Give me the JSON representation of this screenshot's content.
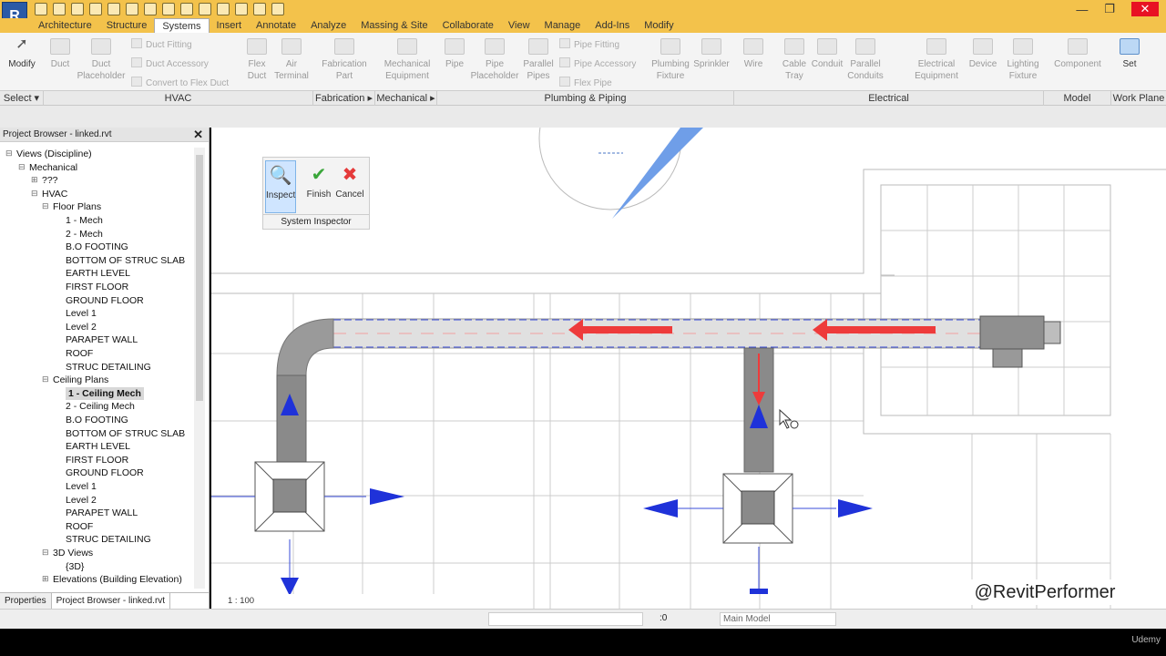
{
  "app": {
    "logo": "R",
    "window_controls": [
      "—",
      "❐",
      "✕"
    ]
  },
  "menu_tabs": [
    "Architecture",
    "Structure",
    "Systems",
    "Insert",
    "Annotate",
    "Analyze",
    "Massing & Site",
    "Collaborate",
    "View",
    "Manage",
    "Add-Ins",
    "Modify"
  ],
  "active_tab": "Systems",
  "ribbon": {
    "modify": "Modify",
    "select": "Select",
    "hvac": {
      "duct": "Duct",
      "duct_placeholder": "Duct\nPlaceholder",
      "duct_fitting": "Duct Fitting",
      "duct_accessory": "Duct Accessory",
      "convert_flex": "Convert to Flex Duct",
      "flex_duct": "Flex\nDuct",
      "air_terminal": "Air\nTerminal"
    },
    "fabrication_part": "Fabrication\nPart",
    "mechanical_equipment": "Mechanical\nEquipment",
    "plumbing": {
      "pipe": "Pipe",
      "pipe_placeholder": "Pipe\nPlaceholder",
      "parallel_pipes": "Parallel\nPipes",
      "pipe_fitting": "Pipe Fitting",
      "pipe_accessory": "Pipe Accessory",
      "flex_pipe": "Flex Pipe",
      "plumbing_fixture": "Plumbing\nFixture",
      "sprinkler": "Sprinkler"
    },
    "electrical": {
      "wire": "Wire",
      "cable_tray": "Cable\nTray",
      "conduit": "Conduit",
      "parallel_conduits": "Parallel\nConduits",
      "electrical_equipment": "Electrical\nEquipment",
      "device": "Device",
      "lighting_fixture": "Lighting\nFixture"
    },
    "component": "Component",
    "set": "Set",
    "groups": {
      "select": "Select ▾",
      "hvac": "HVAC",
      "fabrication": "Fabrication ▸",
      "mechanical": "Mechanical ▸",
      "plumbing": "Plumbing & Piping",
      "electrical": "Electrical",
      "model": "Model",
      "work_plane": "Work Plane"
    }
  },
  "project_browser": {
    "title": "Project Browser - linked.rvt",
    "close": "✕",
    "tree": [
      {
        "label": "Views (Discipline)",
        "level": 0,
        "exp": "⊟"
      },
      {
        "label": "Mechanical",
        "level": 1,
        "exp": "⊟"
      },
      {
        "label": "???",
        "level": 2,
        "exp": "⊞"
      },
      {
        "label": "HVAC",
        "level": 2,
        "exp": "⊟"
      },
      {
        "label": "Floor Plans",
        "level": 3,
        "exp": "⊟"
      },
      {
        "label": "1 - Mech",
        "level": 4
      },
      {
        "label": "2 - Mech",
        "level": 4
      },
      {
        "label": "B.O FOOTING",
        "level": 4
      },
      {
        "label": "BOTTOM OF STRUC SLAB",
        "level": 4
      },
      {
        "label": "EARTH LEVEL",
        "level": 4
      },
      {
        "label": "FIRST FLOOR",
        "level": 4
      },
      {
        "label": "GROUND FLOOR",
        "level": 4
      },
      {
        "label": "Level 1",
        "level": 4
      },
      {
        "label": "Level 2",
        "level": 4
      },
      {
        "label": "PARAPET WALL",
        "level": 4
      },
      {
        "label": "ROOF",
        "level": 4
      },
      {
        "label": "STRUC DETAILING",
        "level": 4
      },
      {
        "label": "Ceiling Plans",
        "level": 3,
        "exp": "⊟"
      },
      {
        "label": "1 - Ceiling Mech",
        "level": 4,
        "selected": true
      },
      {
        "label": "2 - Ceiling Mech",
        "level": 4
      },
      {
        "label": "B.O FOOTING",
        "level": 4
      },
      {
        "label": "BOTTOM OF STRUC SLAB",
        "level": 4
      },
      {
        "label": "EARTH LEVEL",
        "level": 4
      },
      {
        "label": "FIRST FLOOR",
        "level": 4
      },
      {
        "label": "GROUND FLOOR",
        "level": 4
      },
      {
        "label": "Level 1",
        "level": 4
      },
      {
        "label": "Level 2",
        "level": 4
      },
      {
        "label": "PARAPET WALL",
        "level": 4
      },
      {
        "label": "ROOF",
        "level": 4
      },
      {
        "label": "STRUC DETAILING",
        "level": 4
      },
      {
        "label": "3D Views",
        "level": 3,
        "exp": "⊟"
      },
      {
        "label": "{3D}",
        "level": 4
      },
      {
        "label": "Elevations (Building Elevation)",
        "level": 3,
        "exp": "⊞"
      }
    ],
    "tabs": [
      "Properties",
      "Project Browser - linked.rvt"
    ]
  },
  "system_inspector": {
    "inspect": "Inspect",
    "finish": "Finish",
    "cancel": "Cancel",
    "label": "System Inspector"
  },
  "view_control": {
    "scale": "1 : 100"
  },
  "status_bar": {
    "model": "Main Model",
    "zero": ":0"
  },
  "watermark": "@RevitPerformer",
  "udemy": "Udemy"
}
